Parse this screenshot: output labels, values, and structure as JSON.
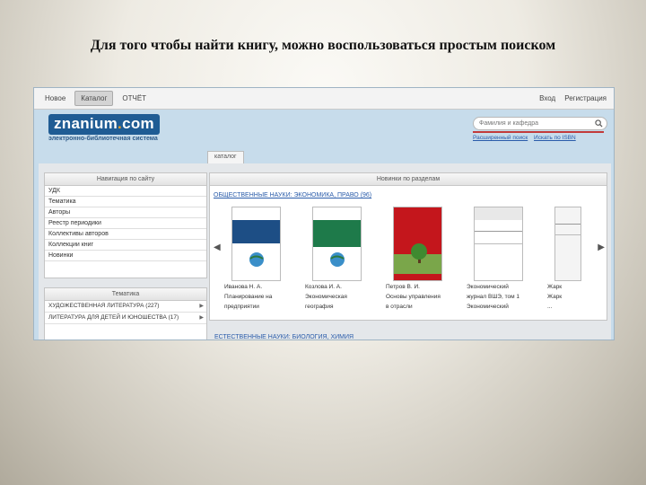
{
  "slide": {
    "title": "Для того чтобы найти книгу, можно воспользоваться простым поиском"
  },
  "topbar": {
    "tabs": [
      "Новое",
      "Каталог",
      "ОТЧЁТ"
    ],
    "right": [
      "Вход",
      "Регистрация"
    ]
  },
  "header": {
    "logo_text": "znanium",
    "logo_dot": ".",
    "logo_tail": "com",
    "tagline": "электронно-библиотечная система"
  },
  "search": {
    "placeholder": "Фамилия и кафедра",
    "links": [
      "Расширенный поиск",
      "Искать по ISBN"
    ]
  },
  "catalog_tab": "каталог",
  "navigation": {
    "title": "Навигация по сайту",
    "items": [
      "УДК",
      "Тематика",
      "Авторы",
      "Реестр периодики",
      "Коллективы авторов",
      "Коллекции книг",
      "Новинки"
    ]
  },
  "themes": {
    "title": "Тематика",
    "items": [
      "ХУДОЖЕСТВЕННАЯ ЛИТЕРАТУРА (227)",
      "ЛИТЕРАТУРА ДЛЯ ДЕТЕЙ И ЮНОШЕСТВА (17)"
    ]
  },
  "new_books": {
    "title": "Новинки по разделам",
    "section_link": "ОБЩЕСТВЕННЫЕ НАУКИ: ЭКОНОМИКА, ПРАВО (96)",
    "books": [
      {
        "author": "Иванова Н. А.",
        "title": "Планирование на",
        "title2": "предприятии"
      },
      {
        "author": "Козлова И. А.",
        "title": "Экономическая",
        "title2": "география"
      },
      {
        "author": "Петров В. И.",
        "title": "Основы управления",
        "title2": "в отрасли"
      },
      {
        "author": "Экономический",
        "title": "журнал ВШЭ, том 1",
        "title2": "Экономический"
      },
      {
        "author": "Жарк",
        "title": "Жарк",
        "title2": "..."
      }
    ],
    "bottom_link": "ЕСТЕСТВЕННЫЕ НАУКИ: БИОЛОГИЯ, ХИМИЯ"
  },
  "colors": {
    "brand": "#1f5c94",
    "link": "#2a5caa",
    "accent": "#c23a3a"
  }
}
